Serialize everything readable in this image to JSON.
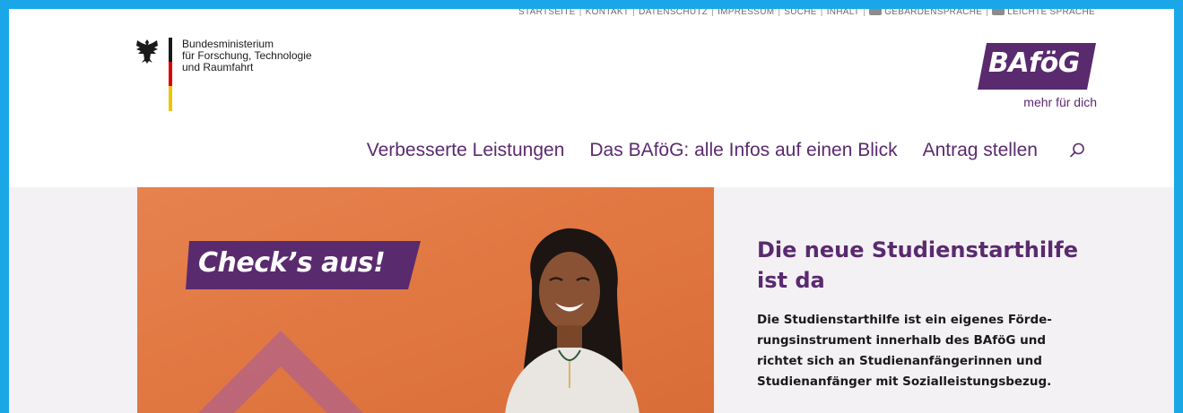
{
  "utility_nav": {
    "items": [
      "STARTSEITE",
      "KONTAKT",
      "DATENSCHUTZ",
      "IMPRESSUM",
      "SUCHE",
      "INHALT"
    ],
    "sign_language": "GEBÄRDENSPRACHE",
    "easy_language": "LEICHTE SPRACHE"
  },
  "ministry": {
    "line1": "Bundesministerium",
    "line2": "für Forschung, Technologie",
    "line3": "und Raumfahrt"
  },
  "bafog_logo": {
    "text": "BAföG",
    "slogan": "mehr für dich",
    "color": "#5a2a6e"
  },
  "main_nav": {
    "items": [
      "Verbesserte Leistungen",
      "Das BAföG: alle Infos auf einen Blick",
      "Antrag stellen"
    ]
  },
  "hero": {
    "badge": "Check’s aus!",
    "title": "Die neue Studienstarthilfe ist da",
    "body": "Die Studienstarthilfe ist ein eigenes Förde-rungsinstrument innerhalb des BAföG und richtet sich an Studienanfängerinnen und Studienanfänger mit Sozialleistungsbezug.",
    "accent": "#5a2a6e",
    "image_bg": "#e07640"
  }
}
